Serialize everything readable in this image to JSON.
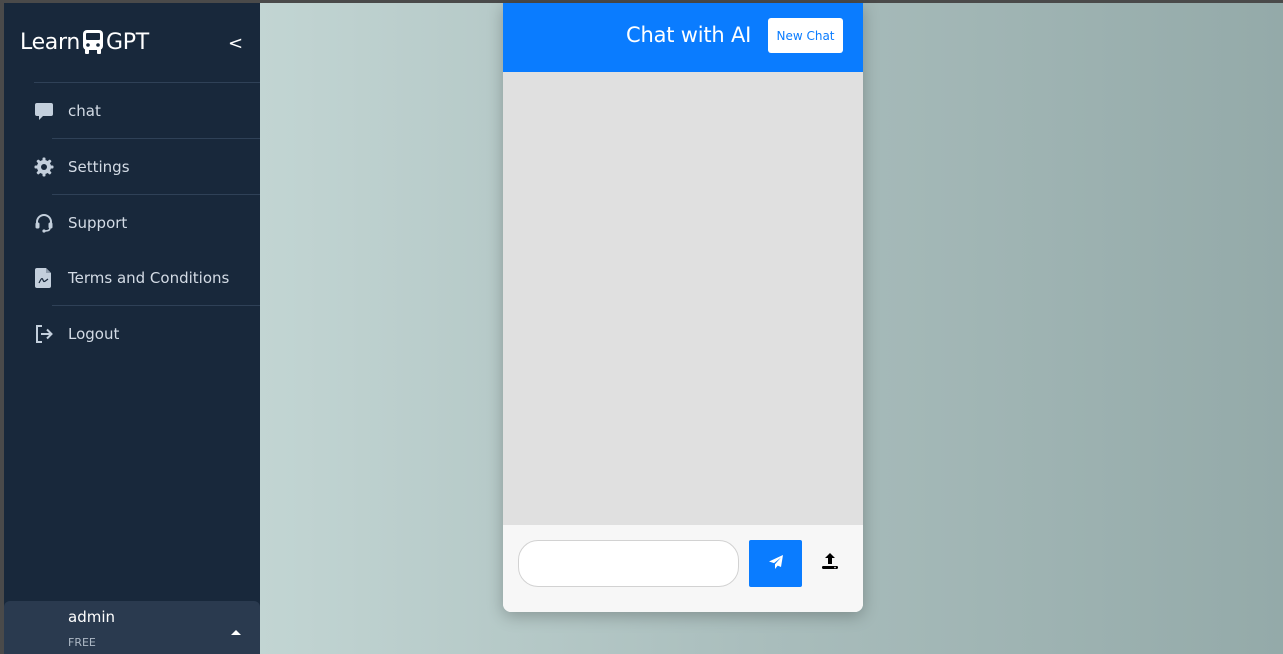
{
  "sidebar": {
    "brand_prefix": "Learn",
    "brand_suffix": "GPT",
    "collapse_label": "<",
    "items": [
      {
        "label": "chat",
        "icon": "chat-bubble-icon"
      },
      {
        "label": "Settings",
        "icon": "gear-icon"
      },
      {
        "label": "Support",
        "icon": "headset-icon"
      },
      {
        "label": "Terms and Conditions",
        "icon": "document-icon"
      },
      {
        "label": "Logout",
        "icon": "logout-icon"
      }
    ],
    "user": {
      "name": "admin",
      "plan": "FREE"
    }
  },
  "chat": {
    "title": "Chat with AI",
    "new_chat_label": "New Chat",
    "input_value": "",
    "send_icon": "paper-plane-icon",
    "upload_icon": "upload-icon"
  },
  "colors": {
    "sidebar_bg": "#18283b",
    "accent": "#0a7cff",
    "chat_body_bg": "#e0e0e0"
  }
}
